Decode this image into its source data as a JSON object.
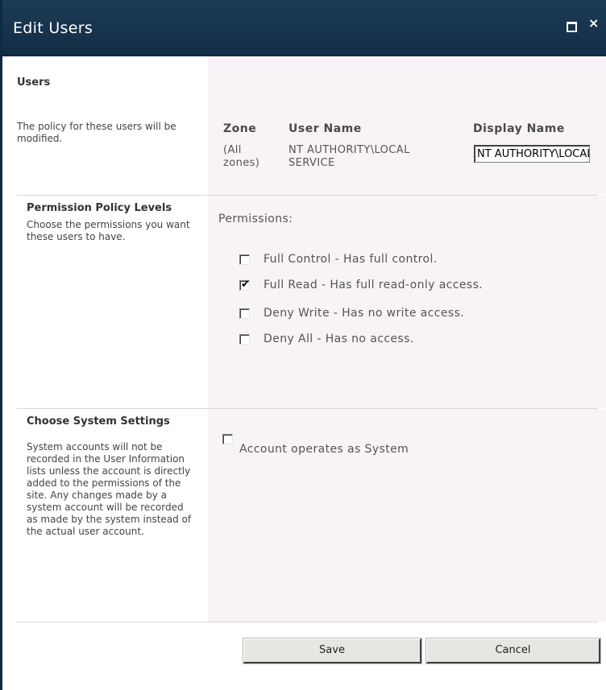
{
  "dialog": {
    "title": "Edit Users",
    "maximize_icon": "maximize-icon",
    "close_icon": "close-icon",
    "close_glyph": "×"
  },
  "users_section": {
    "title": "Users",
    "description": "The policy for these users will be modified.",
    "columns": [
      "Zone",
      "User Name",
      "Display Name"
    ],
    "rows": [
      {
        "zone": "(All zones)",
        "user_name": "NT AUTHORITY\\LOCAL SERVICE",
        "display_name": "NT AUTHORITY\\LOCAL SERVICE"
      }
    ]
  },
  "permission_section": {
    "title": "Permission Policy Levels",
    "description": "Choose the permissions you want these users to have.",
    "label": "Permissions:",
    "options": [
      {
        "label": "Full Control - Has full control.",
        "checked": false
      },
      {
        "label": "Full Read - Has full read-only access.",
        "checked": true
      },
      {
        "label": "Deny Write - Has no write access.",
        "checked": false
      },
      {
        "label": "Deny All - Has no access.",
        "checked": false
      }
    ]
  },
  "system_section": {
    "title": "Choose System Settings",
    "description": "System accounts will not be recorded in the User Information lists unless the account is directly added to the permissions of the site. Any changes made by a system account will be recorded as made by the system instead of the actual user account.",
    "option_label": "Account operates as System",
    "option_checked": false
  },
  "buttons": {
    "save": "Save",
    "cancel": "Cancel"
  },
  "colors": {
    "titlebar": "#1a3650",
    "panel": "#f7f3f6"
  }
}
